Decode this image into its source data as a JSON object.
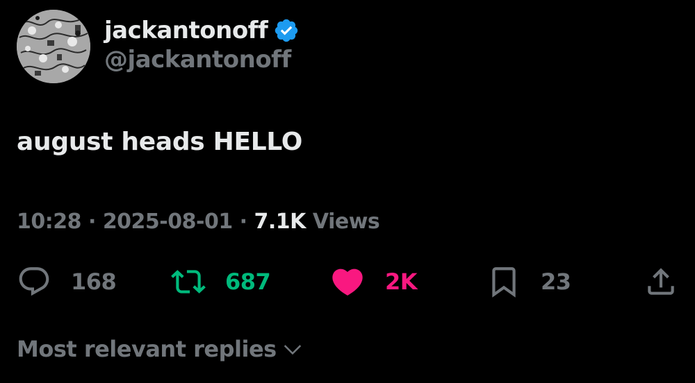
{
  "author": {
    "display_name": "jackantonoff",
    "handle": "@jackantonoff",
    "verified": true,
    "verified_badge_icon": "verified-badge-icon",
    "verified_color": "#1d9bf0"
  },
  "tweet": {
    "text": "august heads HELLO"
  },
  "meta": {
    "time": "10:28",
    "separator": "·",
    "date": "2025-08-01",
    "views_count": "7.1K",
    "views_label": "Views"
  },
  "actions": {
    "reply": {
      "icon": "reply-icon",
      "count": "168",
      "color": "#71767b"
    },
    "repost": {
      "icon": "repost-icon",
      "count": "687",
      "color": "#00ba7c"
    },
    "like": {
      "icon": "heart-icon",
      "count": "2K",
      "color": "#f91880"
    },
    "bookmark": {
      "icon": "bookmark-icon",
      "count": "23",
      "color": "#71767b"
    },
    "share": {
      "icon": "share-icon",
      "color": "#71767b"
    }
  },
  "replies": {
    "sort_label": "Most relevant replies",
    "icon": "chevron-down-icon"
  },
  "colors": {
    "background": "#000000",
    "primary_text": "#e7e9ea",
    "secondary_text": "#71767b"
  }
}
